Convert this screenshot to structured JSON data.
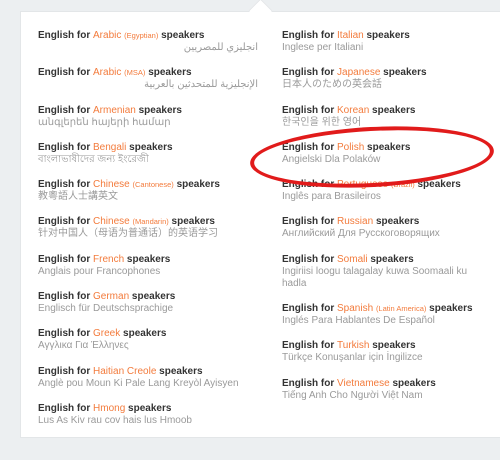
{
  "prefix": "English for",
  "suffix": "speakers",
  "left": [
    {
      "lang": "Arabic",
      "variant": "(Egyptian)",
      "native": "انجليزي للمصريين",
      "rtl": true
    },
    {
      "lang": "Arabic",
      "variant": "(MSA)",
      "native": "الإنجليزية للمتحدثين بالعربية",
      "rtl": true
    },
    {
      "lang": "Armenian",
      "variant": "",
      "native": "անգլերեն հայերի համար"
    },
    {
      "lang": "Bengali",
      "variant": "",
      "native": "বাংলাভাষীদের জন্য ইংরেজী"
    },
    {
      "lang": "Chinese",
      "variant": "(Cantonese)",
      "native": "教粵語人士講英文"
    },
    {
      "lang": "Chinese",
      "variant": "(Mandarin)",
      "native": "针对中国人（母语为普通话）的英语学习"
    },
    {
      "lang": "French",
      "variant": "",
      "native": "Anglais pour Francophones"
    },
    {
      "lang": "German",
      "variant": "",
      "native": "Englisch für Deutschsprachige"
    },
    {
      "lang": "Greek",
      "variant": "",
      "native": "Αγγλικα Για Έλληνες"
    },
    {
      "lang": "Haitian Creole",
      "variant": "",
      "native": "Anglè pou Moun Ki Pale Lang Kreyòl Ayisyen"
    },
    {
      "lang": "Hmong",
      "variant": "",
      "native": "Lus As Kiv rau cov hais lus Hmoob"
    }
  ],
  "right": [
    {
      "lang": "Italian",
      "variant": "",
      "native": "Inglese per Italiani"
    },
    {
      "lang": "Japanese",
      "variant": "",
      "native": "日本人のための英会話"
    },
    {
      "lang": "Korean",
      "variant": "",
      "native": "한국인을 위한 영어"
    },
    {
      "lang": "Polish",
      "variant": "",
      "native": "Angielski Dla Polaków"
    },
    {
      "lang": "Portuguese",
      "variant": "(Brazil)",
      "native": "Inglês para Brasileiros"
    },
    {
      "lang": "Russian",
      "variant": "",
      "native": "Английский Для Русскоговорящих"
    },
    {
      "lang": "Somali",
      "variant": "",
      "native": "Ingiriisi loogu talagalay kuwa Soomaali ku hadla"
    },
    {
      "lang": "Spanish",
      "variant": "(Latin America)",
      "native": "Inglés Para Hablantes De Español"
    },
    {
      "lang": "Turkish",
      "variant": "",
      "native": "Türkçe Konuşanlar için İngilizce"
    },
    {
      "lang": "Vietnamese",
      "variant": "",
      "native": "Tiếng Anh Cho Người Việt Nam"
    }
  ],
  "colors": {
    "accent": "#f37b3c",
    "highlight": "#e11b1b"
  }
}
